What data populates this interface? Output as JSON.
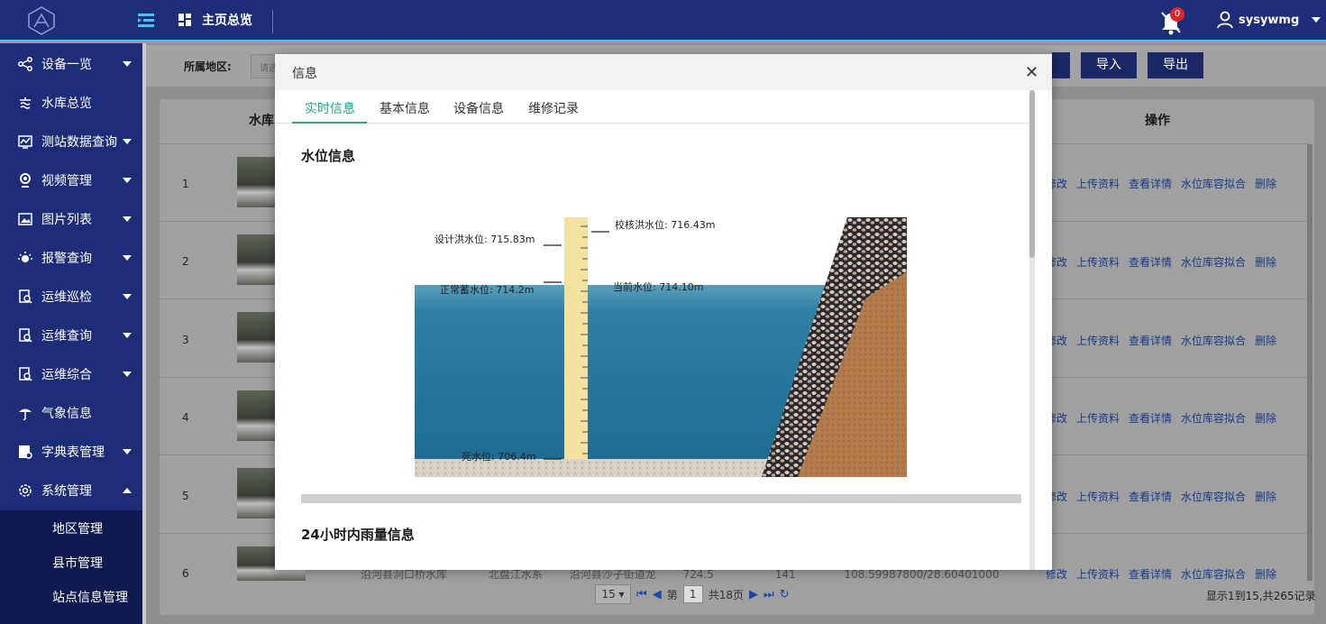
{
  "header": {
    "title": "主页总览",
    "notification_count": "0",
    "username": "sysywmg"
  },
  "sidebar": {
    "items": [
      {
        "label": "设备一览",
        "icon": "share-icon"
      },
      {
        "label": "水库总览",
        "icon": "reservoir-icon"
      },
      {
        "label": "测站数据查询",
        "icon": "chart-icon"
      },
      {
        "label": "视频管理",
        "icon": "camera-icon"
      },
      {
        "label": "图片列表",
        "icon": "image-icon"
      },
      {
        "label": "报警查询",
        "icon": "alarm-icon"
      },
      {
        "label": "运维巡检",
        "icon": "inspect-icon"
      },
      {
        "label": "运维查询",
        "icon": "inspect-icon"
      },
      {
        "label": "运维综合",
        "icon": "inspect-icon"
      },
      {
        "label": "气象信息",
        "icon": "weather-icon"
      },
      {
        "label": "字典表管理",
        "icon": "dictionary-icon"
      },
      {
        "label": "系统管理",
        "icon": "settings-icon"
      }
    ],
    "subitems": [
      {
        "label": "地区管理"
      },
      {
        "label": "县市管理"
      },
      {
        "label": "站点信息管理"
      }
    ]
  },
  "filter": {
    "region_label": "所属地区:",
    "region_placeholder": "请选择",
    "import_label": "导入",
    "export_label": "导出"
  },
  "table": {
    "headers": {
      "name": "水库",
      "actions": "操作"
    },
    "rows": [
      {
        "no": "1"
      },
      {
        "no": "2"
      },
      {
        "no": "3"
      },
      {
        "no": "4"
      },
      {
        "no": "5"
      },
      {
        "no": "6"
      }
    ],
    "actions": {
      "edit": "修改",
      "upload": "上传资料",
      "detail": "查看详情",
      "fit": "水位库容拟合",
      "delete": "删除"
    },
    "row6": {
      "name": "沿河县洞口桥水库",
      "system": "北盘江水系",
      "location": "沿河县沙子街道龙",
      "value1": "724.5",
      "value2": "141",
      "coords": "108.59987800/28.60401000"
    }
  },
  "pager": {
    "page_size": "15",
    "page_prefix": "第",
    "page": "1",
    "total_pages": "共18页",
    "summary": "显示1到15,共265记录"
  },
  "modal": {
    "title": "信息",
    "tabs": [
      {
        "label": "实时信息"
      },
      {
        "label": "基本信息"
      },
      {
        "label": "设备信息"
      },
      {
        "label": "维修记录"
      }
    ],
    "section_water": "水位信息",
    "section_rain": "24小时内雨量信息",
    "water_levels": {
      "check_flood": "校核洪水位: 716.43m",
      "design_flood": "设计洪水位: 715.83m",
      "normal": "正常蓄水位: 714.2m",
      "current": "当前水位: 714.10m",
      "dead": "死水位: 706.4m"
    }
  },
  "colors": {
    "nav_bg": "#1d2d78",
    "accent": "#3ec7f0",
    "tab_active": "#2aa67e",
    "water": "#2f7fa3",
    "gauge": "#f3e29f"
  }
}
